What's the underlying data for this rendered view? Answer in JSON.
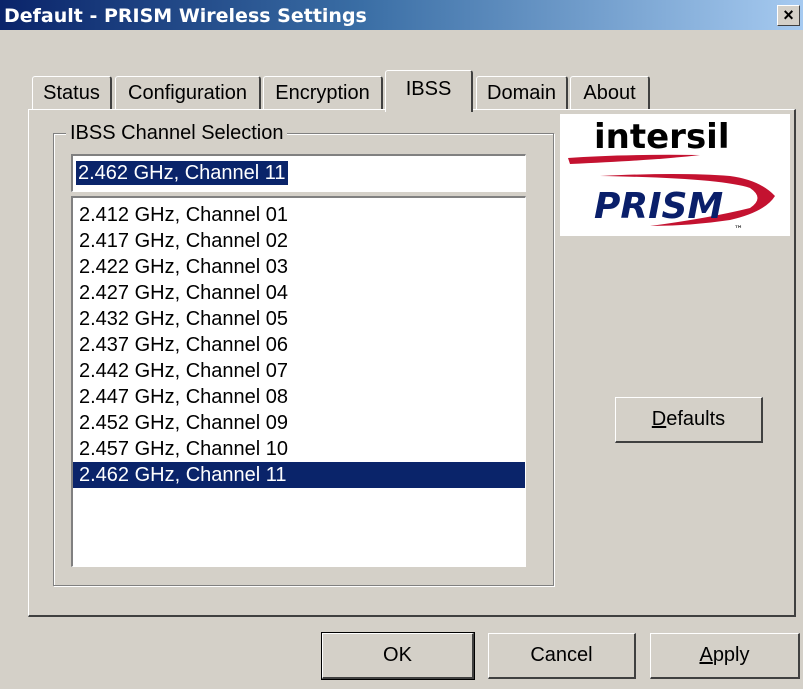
{
  "window": {
    "title": "Default - PRISM Wireless Settings",
    "close_label": "×"
  },
  "tabs": [
    {
      "label": "Status",
      "active": false
    },
    {
      "label": "Configuration",
      "active": false
    },
    {
      "label": "Encryption",
      "active": false
    },
    {
      "label": "IBSS",
      "active": true
    },
    {
      "label": "Domain",
      "active": false
    },
    {
      "label": "About",
      "active": false
    }
  ],
  "ibss": {
    "group_label": "IBSS Channel Selection",
    "selected_value": "2.462 GHz, Channel 11",
    "channels": [
      "2.412 GHz, Channel 01",
      "2.417 GHz, Channel 02",
      "2.422 GHz, Channel 03",
      "2.427 GHz, Channel 04",
      "2.432 GHz, Channel 05",
      "2.437 GHz, Channel 06",
      "2.442 GHz, Channel 07",
      "2.447 GHz, Channel 08",
      "2.452 GHz, Channel 09",
      "2.457 GHz, Channel 10",
      "2.462 GHz, Channel 11"
    ],
    "selected_index": 10
  },
  "logo": {
    "company": "intersil",
    "product": "PRISM",
    "trademark": "™"
  },
  "buttons": {
    "defaults_mnemonic": "D",
    "defaults_rest": "efaults",
    "ok": "OK",
    "cancel": "Cancel",
    "apply_mnemonic": "A",
    "apply_rest": "pply"
  },
  "colors": {
    "face": "#d4d0c8",
    "selection": "#0a246a",
    "logo_red": "#c41230"
  }
}
